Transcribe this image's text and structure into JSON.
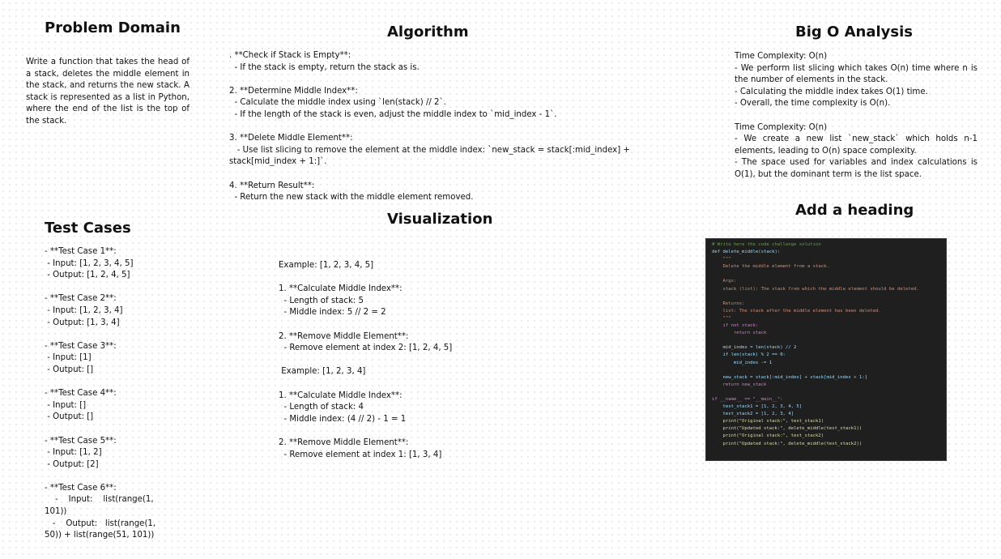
{
  "problem_domain": {
    "heading": "Problem Domain",
    "body": "Write a function that takes the head of a stack, deletes the middle element in the stack, and returns the new stack. A stack is represented as a list in Python, where the end of the list is the top of the stack."
  },
  "algorithm": {
    "heading": "Algorithm",
    "lines": [
      ". **Check if Stack is Empty**:",
      "  - If the stack is empty, return the stack as is.",
      "",
      "2. **Determine Middle Index**:",
      "  - Calculate the middle index using `len(stack) // 2`.",
      "  - If the length of the stack is even, adjust the middle index to `mid_index - 1`.",
      "",
      "3. **Delete Middle Element**:",
      "   - Use list slicing to remove the element at the middle index: `new_stack = stack[:mid_index] +",
      "stack[mid_index + 1:]`.",
      "",
      "4. **Return Result**:",
      "  - Return the new stack with the middle element removed."
    ]
  },
  "big_o": {
    "heading": "Big O Analysis",
    "time_title": "Time Complexity: O(n)",
    "time_lines": [
      " - We perform list slicing which takes O(n) time where n is the number of elements in the stack.",
      " - Calculating the middle index takes O(1) time.",
      " - Overall, the time complexity is O(n)."
    ],
    "space_title": "Time Complexity: O(n)",
    "space_lines": [
      "  - We create a new list `new_stack` which holds n-1 elements, leading to O(n) space complexity.",
      "  - The space used for variables and index calculations is O(1), but the dominant term is the list space."
    ]
  },
  "test_cases": {
    "heading": "Test Cases",
    "lines": [
      "- **Test Case 1**:",
      " - Input: [1, 2, 3, 4, 5]",
      " - Output: [1, 2, 4, 5]",
      "",
      "- **Test Case 2**:",
      " - Input: [1, 2, 3, 4]",
      " - Output: [1, 3, 4]",
      "",
      "- **Test Case 3**:",
      " - Input: [1]",
      " - Output: []",
      "",
      "- **Test Case 4**:",
      " - Input: []",
      " - Output: []",
      "",
      "- **Test Case 5**:",
      " - Input: [1, 2]",
      " - Output: [2]",
      "",
      "- **Test Case 6**:",
      "    -    Input:    list(range(1,",
      "101))",
      "   -    Output:   list(range(1,",
      "50)) + list(range(51, 101))"
    ]
  },
  "visualization": {
    "heading": "Visualization",
    "lines": [
      "Example: [1, 2, 3, 4, 5]",
      "",
      "1. **Calculate Middle Index**:",
      "  - Length of stack: 5",
      "  - Middle index: 5 // 2 = 2",
      "",
      "2. **Remove Middle Element**:",
      "  - Remove element at index 2: [1, 2, 4, 5]",
      "",
      " Example: [1, 2, 3, 4]",
      "",
      "1. **Calculate Middle Index**:",
      "  - Length of stack: 4",
      "  - Middle index: (4 // 2) - 1 = 1",
      "",
      "2. **Remove Middle Element**:",
      "  - Remove element at index 1: [1, 3, 4]"
    ]
  },
  "code_section": {
    "heading": "Add a heading",
    "code_lines": [
      {
        "text": "# Write here the code challenge solution",
        "color": "#6a9955"
      },
      {
        "text": "def delete_middle(stack):",
        "color": "#9cdcfe"
      },
      {
        "text": "    \"\"\"",
        "color": "#ce9178"
      },
      {
        "text": "    Delete the middle element from a stack.",
        "color": "#ce9178"
      },
      {
        "text": "",
        "color": "#ce9178"
      },
      {
        "text": "    Args:",
        "color": "#ce9178"
      },
      {
        "text": "    stack (list): The stack from which the middle element should be deleted.",
        "color": "#ce9178"
      },
      {
        "text": "",
        "color": "#ce9178"
      },
      {
        "text": "    Returns:",
        "color": "#ce9178"
      },
      {
        "text": "    list: The stack after the middle element has been deleted.",
        "color": "#ce9178"
      },
      {
        "text": "    \"\"\"",
        "color": "#ce9178"
      },
      {
        "text": "    if not stack:",
        "color": "#c586c0"
      },
      {
        "text": "        return stack",
        "color": "#c586c0"
      },
      {
        "text": "",
        "color": "#cfd8e3"
      },
      {
        "text": "    mid_index = len(stack) // 2",
        "color": "#9cdcfe"
      },
      {
        "text": "    if len(stack) % 2 == 0:",
        "color": "#9cdcfe"
      },
      {
        "text": "        mid_index -= 1",
        "color": "#9cdcfe"
      },
      {
        "text": "",
        "color": "#cfd8e3"
      },
      {
        "text": "    new_stack = stack[:mid_index] + stack[mid_index + 1:]",
        "color": "#9cdcfe"
      },
      {
        "text": "    return new_stack",
        "color": "#c586c0"
      },
      {
        "text": "",
        "color": "#cfd8e3"
      },
      {
        "text": "if __name__ == \"__main__\":",
        "color": "#c586c0"
      },
      {
        "text": "    test_stack1 = [1, 2, 3, 4, 5]",
        "color": "#9cdcfe"
      },
      {
        "text": "    test_stack2 = [1, 2, 3, 4]",
        "color": "#9cdcfe"
      },
      {
        "text": "    print(\"Original stack:\", test_stack1)",
        "color": "#dcdcaa"
      },
      {
        "text": "    print(\"Updated stack:\", delete_middle(test_stack1))",
        "color": "#dcdcaa"
      },
      {
        "text": "    print(\"Original stack:\", test_stack2)",
        "color": "#dcdcaa"
      },
      {
        "text": "    print(\"Updated stack:\", delete_middle(test_stack2))",
        "color": "#dcdcaa"
      }
    ]
  }
}
